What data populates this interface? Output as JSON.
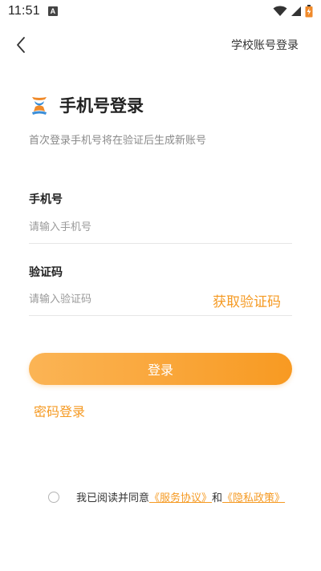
{
  "status_bar": {
    "time": "11:51",
    "indicator": "A",
    "icons": [
      "wifi-icon",
      "signal-icon",
      "battery-icon"
    ]
  },
  "nav": {
    "back_icon": "chevron-left-icon",
    "school_login": "学校账号登录"
  },
  "header": {
    "logo_icon": "app-logo-icon",
    "title": "手机号登录",
    "subtitle": "首次登录手机号将在验证后生成新账号"
  },
  "phone": {
    "label": "手机号",
    "placeholder": "请输入手机号",
    "value": ""
  },
  "code": {
    "label": "验证码",
    "placeholder": "请输入验证码",
    "value": "",
    "get_code": "获取验证码"
  },
  "login_button": "登录",
  "password_login": "密码登录",
  "agreement": {
    "prefix": "我已阅读并同意",
    "service": "《服务协议》",
    "and": "和",
    "privacy": "《隐私政策》"
  },
  "colors": {
    "accent": "#f59a23",
    "button_gradient_start": "#fbb455",
    "button_gradient_end": "#f89a22"
  }
}
